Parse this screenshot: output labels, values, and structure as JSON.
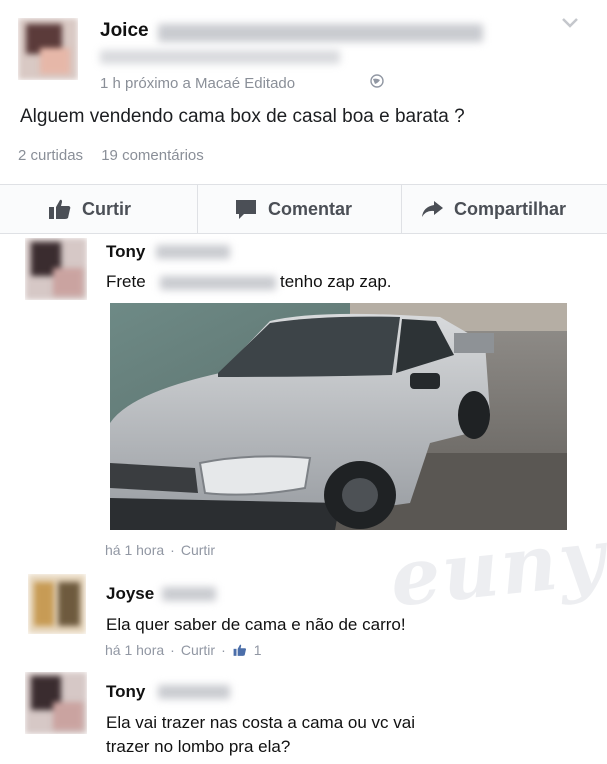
{
  "post": {
    "author": "Joice",
    "meta": "1 h próximo a Macaé Editado",
    "text": "Alguem vendendo cama box de casal boa e barata ?",
    "likes_count": "2 curtidas",
    "comments_count": "19 comentários"
  },
  "actions": {
    "like": "Curtir",
    "comment": "Comentar",
    "share": "Compartilhar"
  },
  "comments": [
    {
      "author": "Tony",
      "text_before": "Frete",
      "text_after": "tenho zap zap.",
      "time": "há 1 hora",
      "action": "Curtir"
    },
    {
      "author": "Joyse",
      "text": "Ela quer saber de cama e não de carro!",
      "time": "há 1 hora",
      "action": "Curtir",
      "likes": "1"
    },
    {
      "author": "Tony",
      "text_line1": "Ela vai trazer nas costa a cama ou vc vai",
      "text_line2": "trazer no lombo pra ela?"
    }
  ],
  "separator": "·",
  "icons": {
    "globe": "globe-icon",
    "chevron": "chevron-down-icon",
    "like": "thumbs-up-icon",
    "comment": "speech-bubble-icon",
    "share": "share-arrow-icon"
  },
  "colors": {
    "meta_gray": "#8a8f98",
    "action_gray": "#4b4f56",
    "text": "#141823"
  }
}
